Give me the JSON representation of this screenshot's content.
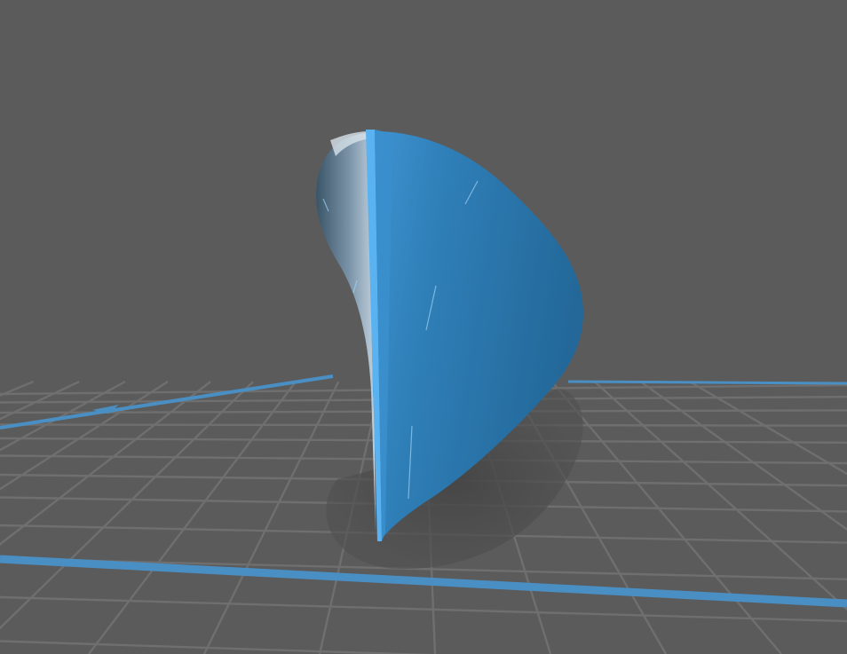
{
  "viewport": {
    "background_color": "#5b5b5b",
    "grid_line_color": "#6f6f6f",
    "bed_edge_color": "#4a8fc4"
  },
  "model": {
    "shape": "hull-shell",
    "face_color": "#2f7fb8",
    "highlight_color": "#5ab2f0",
    "inner_color": "#8fa7bd",
    "shadow_color": "#4b4b4b"
  }
}
